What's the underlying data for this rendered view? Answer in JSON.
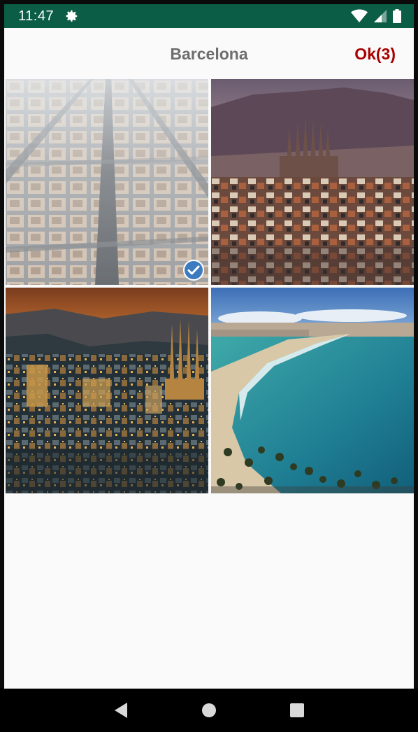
{
  "status_bar": {
    "time": "11:47",
    "icons": [
      "gear-icon",
      "wifi-icon",
      "cell-signal-icon",
      "battery-icon"
    ]
  },
  "toolbar": {
    "title": "Barcelona",
    "ok_label": "Ok(3)"
  },
  "photos": [
    {
      "subject": "aerial-city-grid",
      "selected": true
    },
    {
      "subject": "sagrada-familia-skyline",
      "selected": false
    },
    {
      "subject": "city-at-sunset",
      "selected": false
    },
    {
      "subject": "beach-coastline",
      "selected": false
    }
  ],
  "nav_bar": {
    "icons": [
      "back-icon",
      "home-icon",
      "recents-icon"
    ]
  },
  "colors": {
    "status_bar": "#0b5e45",
    "title": "#6e6e6e",
    "ok_accent": "#a80000",
    "check": "#3d7bc1"
  }
}
